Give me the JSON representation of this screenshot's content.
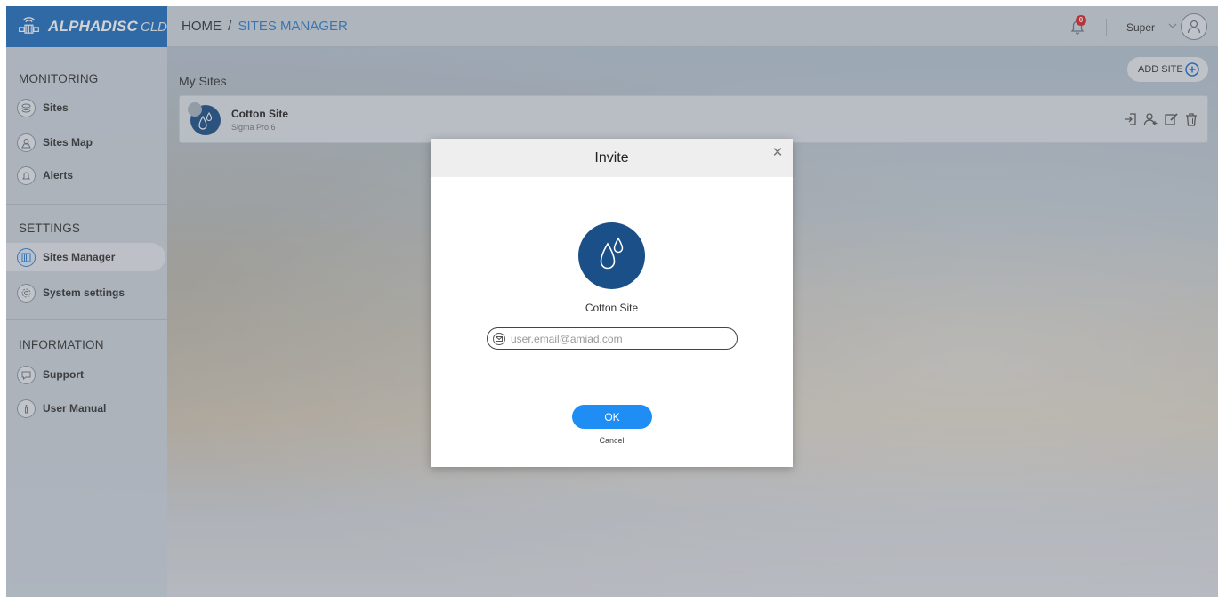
{
  "header": {
    "brand": "ALPHADISC",
    "brand_suffix": "CLD",
    "breadcrumb_home": "HOME",
    "breadcrumb_sep": "/",
    "breadcrumb_current": "SITES MANAGER",
    "notification_count": "0",
    "user_name": "Super"
  },
  "sidebar": {
    "sections": [
      {
        "title": "MONITORING",
        "items": [
          {
            "label": "Sites",
            "icon": "layers-icon"
          },
          {
            "label": "Sites Map",
            "icon": "map-pin-icon"
          },
          {
            "label": "Alerts",
            "icon": "bell-icon"
          }
        ]
      },
      {
        "title": "SETTINGS",
        "items": [
          {
            "label": "Sites Manager",
            "icon": "sites-manager-icon",
            "active": true
          },
          {
            "label": "System settings",
            "icon": "gear-icon"
          }
        ]
      },
      {
        "title": "INFORMATION",
        "items": [
          {
            "label": "Support",
            "icon": "chat-icon"
          },
          {
            "label": "User Manual",
            "icon": "manual-icon"
          }
        ]
      }
    ]
  },
  "main": {
    "title": "My Sites",
    "add_site_label": "ADD SITE",
    "sites": [
      {
        "name": "Cotton Site",
        "model": "Sigma Pro 6"
      }
    ]
  },
  "modal": {
    "title": "Invite",
    "site_name": "Cotton Site",
    "email_placeholder": "user.email@amiad.com",
    "email_value": "",
    "ok_label": "OK",
    "cancel_label": "Cancel"
  },
  "colors": {
    "brand_blue": "#1f6fbf",
    "accent_blue": "#2f7fd0",
    "ok_button": "#1e8ef5",
    "site_icon": "#1b4f87",
    "badge_red": "#d8262b"
  }
}
